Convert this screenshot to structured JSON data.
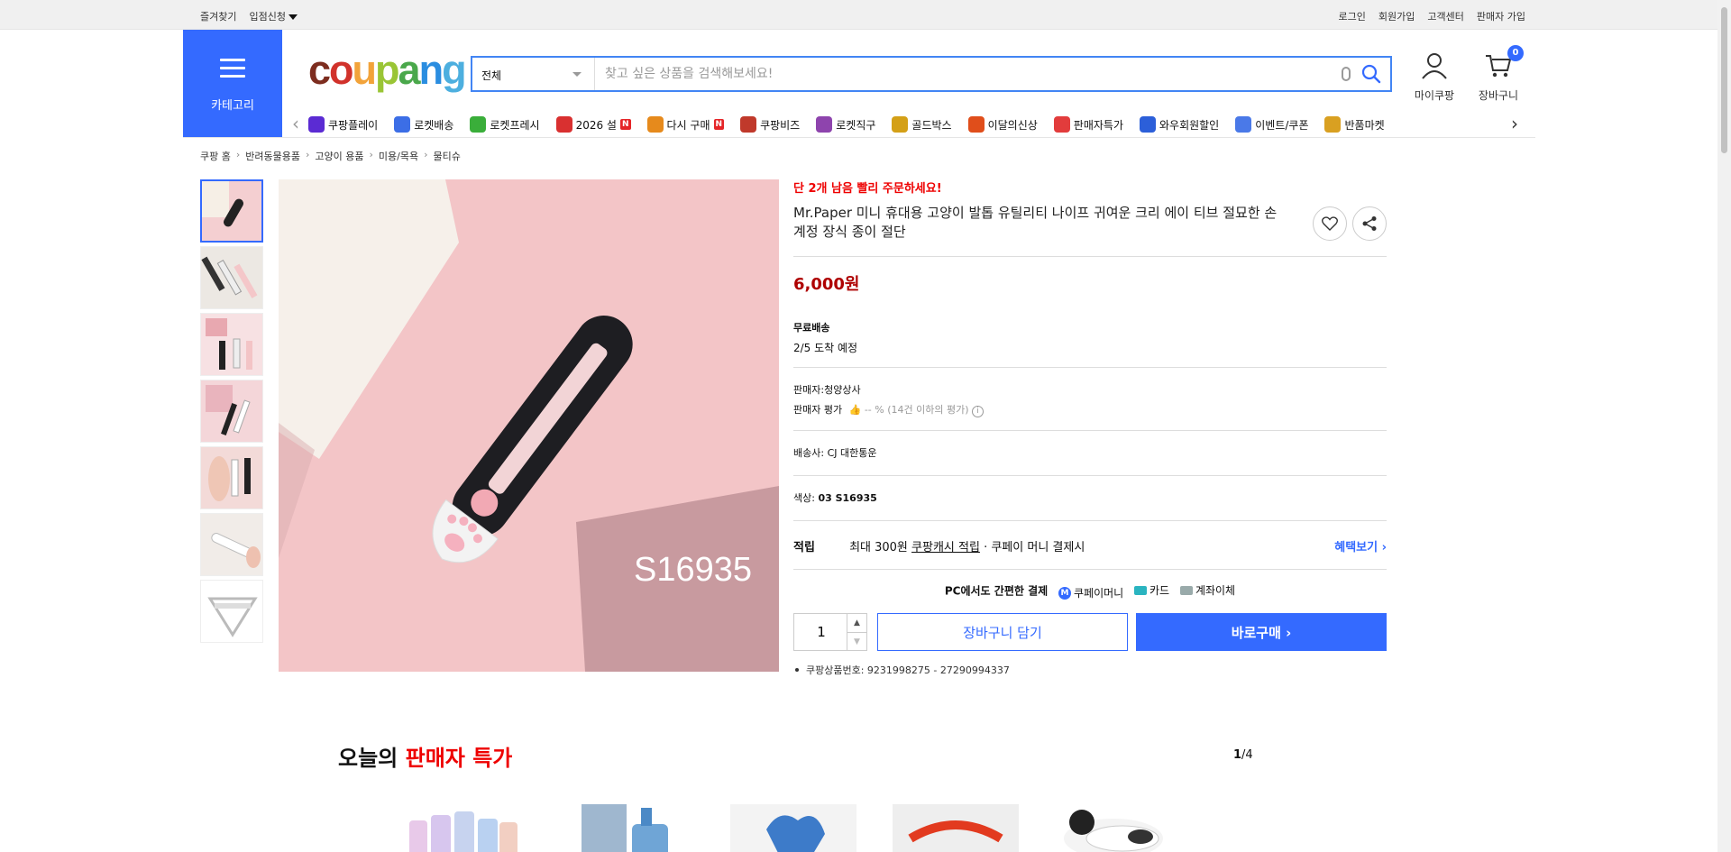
{
  "topbar": {
    "left": [
      "즐겨찾기",
      "입점신청"
    ],
    "right": [
      "로그인",
      "회원가입",
      "고객센터",
      "판매자 가입"
    ]
  },
  "category_label": "카테고리",
  "logo": {
    "letters": [
      "c",
      "o",
      "u",
      "p",
      "a",
      "n",
      "g"
    ],
    "colors": [
      "#7d2d1f",
      "#d1322b",
      "#f2a33a",
      "#9ac535",
      "#4aa84b",
      "#2a8de0",
      "#4dafdf"
    ]
  },
  "search": {
    "category": "전체",
    "placeholder": "찾고 싶은 상품을 검색해보세요!"
  },
  "header_icons": {
    "mycoupang": "마이쿠팡",
    "cart": "장바구니",
    "cart_count": "0"
  },
  "nav": [
    {
      "label": "쿠팡플레이",
      "icon": "coupang-play-icon",
      "color": "#5b2bd3"
    },
    {
      "label": "로켓배송",
      "icon": "rocket-icon",
      "color": "#3c6ee6"
    },
    {
      "label": "로켓프레시",
      "icon": "rocket-fresh-icon",
      "color": "#3aae3a"
    },
    {
      "label": "2026 설",
      "icon": "gift-icon",
      "color": "#d93030",
      "badge": "N"
    },
    {
      "label": "다시 구매",
      "icon": "home-icon",
      "color": "#e68a1c",
      "badge": "N"
    },
    {
      "label": "쿠팡비즈",
      "icon": "biz-icon",
      "color": "#c0392b"
    },
    {
      "label": "로켓직구",
      "icon": "global-icon",
      "color": "#8e44ad"
    },
    {
      "label": "골드박스",
      "icon": "gold-box-icon",
      "color": "#d4a017"
    },
    {
      "label": "이달의신상",
      "icon": "new-icon",
      "color": "#e04e1b"
    },
    {
      "label": "판매자특가",
      "icon": "percent-icon",
      "color": "#e23c3c"
    },
    {
      "label": "와우회원할인",
      "icon": "wow-icon",
      "color": "#2c5fd9"
    },
    {
      "label": "이벤트/쿠폰",
      "icon": "coupon-icon",
      "color": "#4a79e8"
    },
    {
      "label": "반품마켓",
      "icon": "market-icon",
      "color": "#d9a021"
    }
  ],
  "breadcrumb": [
    "쿠팡 홈",
    "반려동물용품",
    "고양이 용품",
    "미용/목욕",
    "물티슈"
  ],
  "product": {
    "urgency": "단 2개 남음 빨리 주문하세요!",
    "title": "Mr.Paper 미니 휴대용 고양이 발톱 유틸리티 나이프 귀여운 크리 에이 티브 절묘한 손 계정 장식 종이 절단",
    "price": "6,000원",
    "shipping_label": "무료배송",
    "arrival": "2/5 도착 예정",
    "seller_label": "판매자:",
    "seller": "청양상사",
    "rating_label": "판매자 평가",
    "rating_value": "-- %",
    "rating_note": "(14건 이하의 평가)",
    "carrier_label": "배송사:",
    "carrier": "CJ 대한통운",
    "color_label": "색상:",
    "color_value": "03 S16935",
    "image_text": "S16935",
    "reward_label": "적립",
    "reward_text1": "최대 300원",
    "reward_link": "쿠팡캐시 적립",
    "reward_text2": "· 쿠페이 머니 결제시",
    "benefit_link": "혜택보기 ›",
    "pay_title": "PC에서도 간편한 결제",
    "pay_methods": [
      "쿠페이머니",
      "카드",
      "계좌이체"
    ],
    "quantity": "1",
    "cart_button": "장바구니 담기",
    "buy_button": "바로구매 ›",
    "product_number": "쿠팡상품번호: 9231998275 - 27290994337"
  },
  "section": {
    "title_black": "오늘의",
    "title_red": "판매자 특가",
    "page_current": "1",
    "page_total": "/4"
  }
}
